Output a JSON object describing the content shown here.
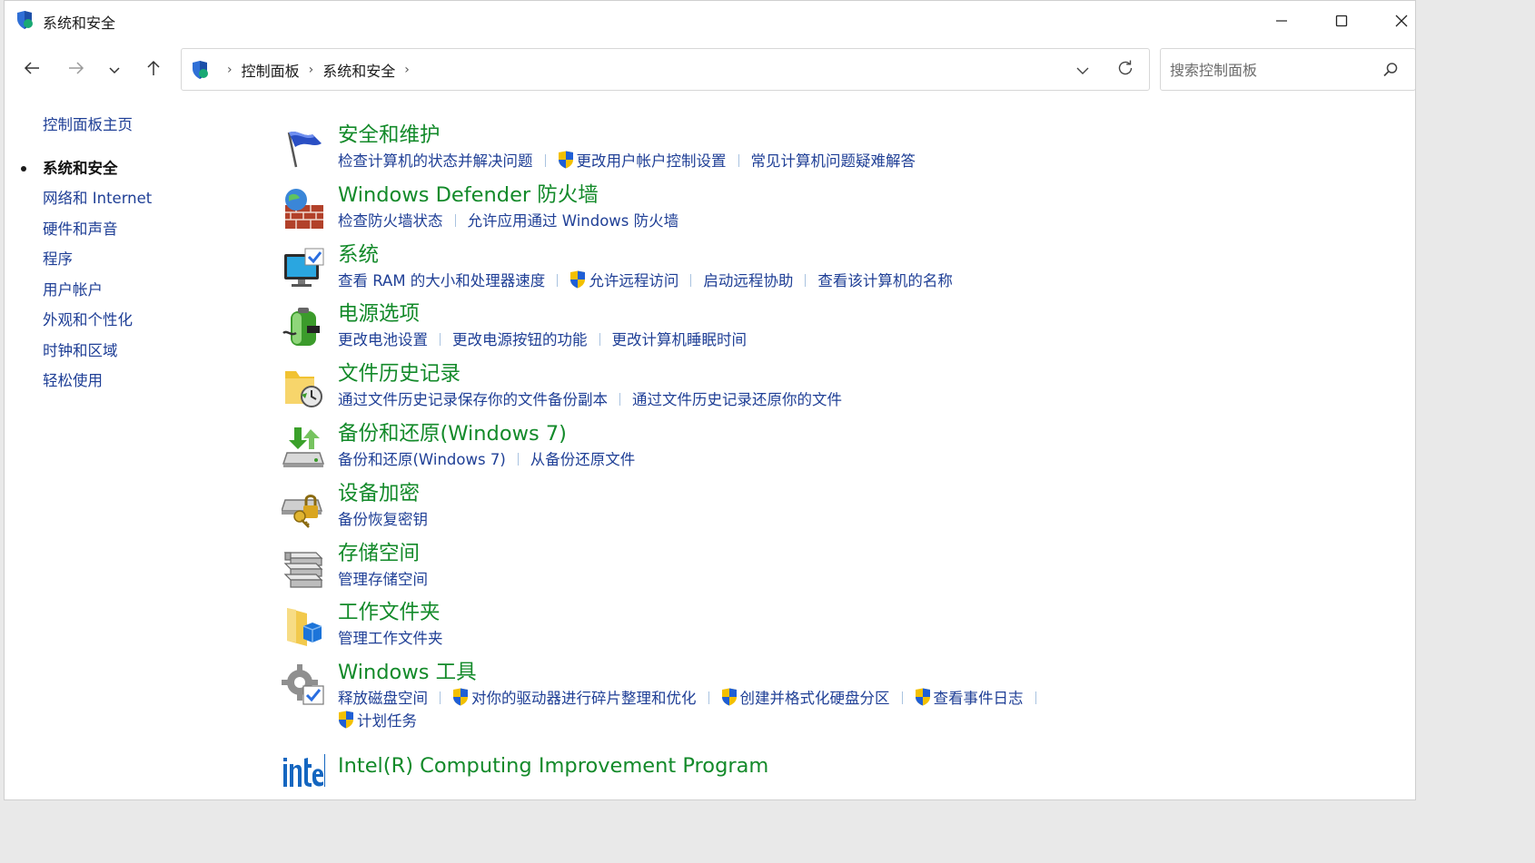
{
  "window": {
    "title": "系统和安全"
  },
  "address_bar": {
    "crumbs": [
      "控制面板",
      "系统和安全"
    ]
  },
  "search": {
    "placeholder": "搜索控制面板"
  },
  "sidebar": {
    "home": "控制面板主页",
    "items": [
      {
        "label": "系统和安全",
        "current": true
      },
      {
        "label": "网络和 Internet",
        "current": false
      },
      {
        "label": "硬件和声音",
        "current": false
      },
      {
        "label": "程序",
        "current": false
      },
      {
        "label": "用户帐户",
        "current": false
      },
      {
        "label": "外观和个性化",
        "current": false
      },
      {
        "label": "时钟和区域",
        "current": false
      },
      {
        "label": "轻松使用",
        "current": false
      }
    ]
  },
  "categories": [
    {
      "title": "安全和维护",
      "icon": "flag-icon",
      "links": [
        {
          "label": "检查计算机的状态并解决问题",
          "shield": false
        },
        {
          "label": "更改用户帐户控制设置",
          "shield": true
        },
        {
          "label": "常见计算机问题疑难解答",
          "shield": false
        }
      ]
    },
    {
      "title": "Windows Defender 防火墙",
      "icon": "firewall-icon",
      "links": [
        {
          "label": "检查防火墙状态",
          "shield": false
        },
        {
          "label": "允许应用通过 Windows 防火墙",
          "shield": false
        }
      ]
    },
    {
      "title": "系统",
      "icon": "computer-icon",
      "links": [
        {
          "label": "查看 RAM 的大小和处理器速度",
          "shield": false
        },
        {
          "label": "允许远程访问",
          "shield": true
        },
        {
          "label": "启动远程协助",
          "shield": false
        },
        {
          "label": "查看该计算机的名称",
          "shield": false
        }
      ]
    },
    {
      "title": "电源选项",
      "icon": "battery-icon",
      "links": [
        {
          "label": "更改电池设置",
          "shield": false
        },
        {
          "label": "更改电源按钮的功能",
          "shield": false
        },
        {
          "label": "更改计算机睡眠时间",
          "shield": false
        }
      ]
    },
    {
      "title": "文件历史记录",
      "icon": "file-history-icon",
      "links": [
        {
          "label": "通过文件历史记录保存你的文件备份副本",
          "shield": false
        },
        {
          "label": "通过文件历史记录还原你的文件",
          "shield": false
        }
      ]
    },
    {
      "title": "备份和还原(Windows 7)",
      "icon": "backup-icon",
      "links": [
        {
          "label": "备份和还原(Windows 7)",
          "shield": false
        },
        {
          "label": "从备份还原文件",
          "shield": false
        }
      ]
    },
    {
      "title": "设备加密",
      "icon": "encryption-key-icon",
      "links": [
        {
          "label": "备份恢复密钥",
          "shield": false
        }
      ]
    },
    {
      "title": "存储空间",
      "icon": "storage-drives-icon",
      "links": [
        {
          "label": "管理存储空间",
          "shield": false
        }
      ]
    },
    {
      "title": "工作文件夹",
      "icon": "work-folders-icon",
      "links": [
        {
          "label": "管理工作文件夹",
          "shield": false
        }
      ]
    },
    {
      "title": "Windows 工具",
      "icon": "tools-gear-icon",
      "links": [
        {
          "label": "释放磁盘空间",
          "shield": false
        },
        {
          "label": "对你的驱动器进行碎片整理和优化",
          "shield": true
        },
        {
          "label": "创建并格式化硬盘分区",
          "shield": true
        },
        {
          "label": "查看事件日志",
          "shield": true
        },
        {
          "label": "计划任务",
          "shield": true
        }
      ]
    },
    {
      "title": "Intel(R) Computing Improvement Program",
      "icon": "intel-logo-icon",
      "links": []
    }
  ],
  "colors": {
    "link": "#1f3f96",
    "category_title": "#138a2a",
    "link_separator": "#a9c3e0"
  }
}
